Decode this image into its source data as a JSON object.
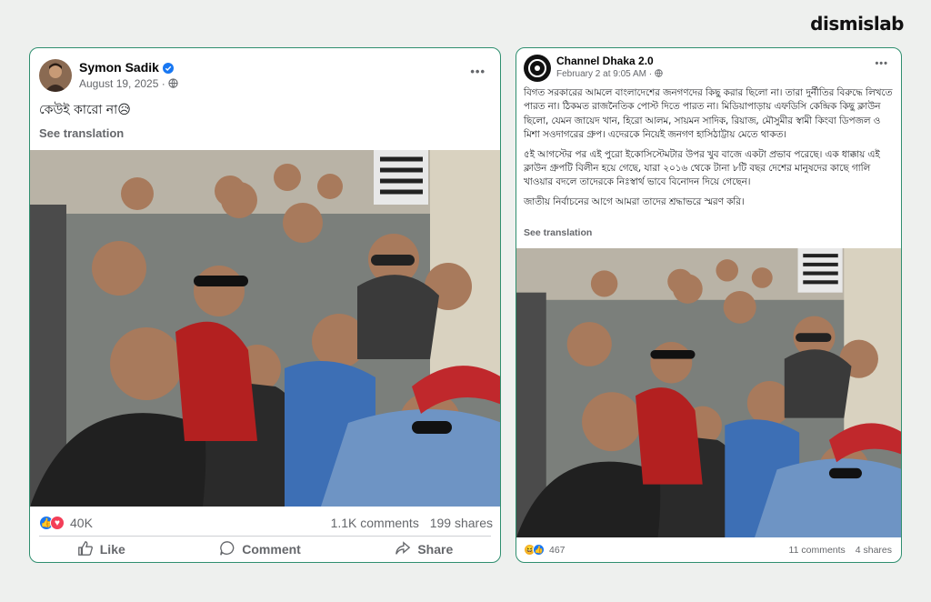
{
  "brand": {
    "logo_text": "dismislab"
  },
  "left_post": {
    "author": "Symon Sadik",
    "date": "August 19, 2025",
    "more": "•••",
    "text": "কেউই কারো না😥",
    "see_translation": "See translation",
    "reaction_count": "40K",
    "comments": "1.1K comments",
    "shares": "199 shares",
    "actions": {
      "like": "Like",
      "comment": "Comment",
      "share": "Share"
    },
    "icons": [
      "verified-icon",
      "globe-icon",
      "like-reaction-icon",
      "love-reaction-icon",
      "like-icon",
      "comment-icon",
      "share-icon"
    ]
  },
  "right_post": {
    "author": "Channel Dhaka 2.0",
    "date": "February 2 at 9:05 AM",
    "more": "•••",
    "paragraphs": [
      "বিগত সরকারের আমলে বাংলাদেশের জনগণদের কিছু করার ছিলো না। তারা দুর্নীতির বিরুদ্ধে লিখতে পারত না। ঠিকমত রাজনৈতিক পোস্ট দিতে পারত না। মিডিয়াপাড়ায় এফডিসি কেন্দ্রিক কিছু ক্লাউন ছিলো, যেমন জায়েদ খান, হিরো আলম, সায়মন সাদিক, রিয়াজ, মৌসুমীর স্বামী কিংবা ডিপজল ও মিশা সওদাগরের গ্রুপ। এদেরকে নিয়েই জনগণ হাসিঠাট্টায় মেতে থাকত।",
      "৫ই আগস্টের পর এই পুরো ইকোসিস্টেমটার উপর খুব বাজে একটা প্রভাব পরেছে। এক ধাক্কায় এই ক্লাউন গ্রুপটি বিলীন হয়ে গেছে, যারা ২০১৬ থেকে টানা ৮টি বছর দেশের মানুষদের কাছে গালি খাওয়ার বদলে তাদেরকে নিঃস্বার্থ ভাবে বিনোদন দিয়ে গেছেন।",
      "জাতীয় নির্বাচনের আগে আমরা তাদের শ্রদ্ধাভরে স্মরণ করি।"
    ],
    "see_translation": "See translation",
    "reaction_count": "467",
    "comments": "11 comments",
    "shares": "4 shares",
    "icons": [
      "globe-icon",
      "haha-reaction-icon",
      "like-reaction-icon"
    ]
  },
  "colors": {
    "frame_border": "#2f8f6f",
    "fb_blue": "#1877f2",
    "love_red": "#f33e58",
    "haha_yellow": "#f7b125"
  }
}
